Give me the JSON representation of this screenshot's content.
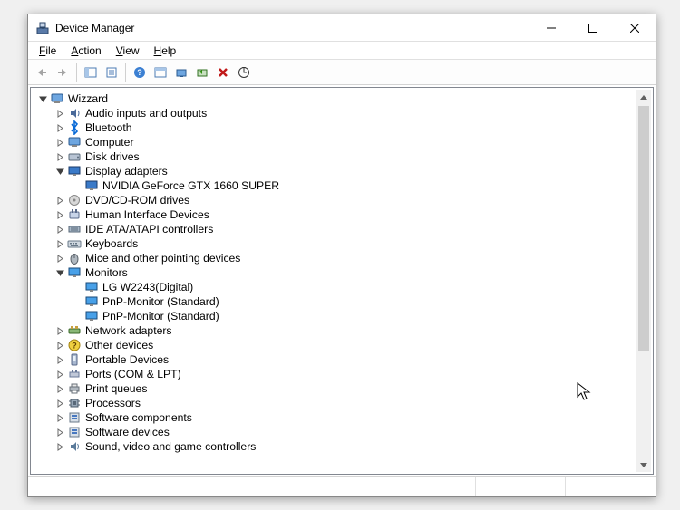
{
  "window": {
    "title": "Device Manager"
  },
  "menu": {
    "file": "File",
    "action": "Action",
    "view": "View",
    "help": "Help"
  },
  "toolbar_icons": [
    "back",
    "forward",
    "up-level",
    "show-hide-tree",
    "help",
    "properties",
    "update",
    "computer",
    "add-legacy",
    "remove",
    "rescan"
  ],
  "tree": {
    "root": {
      "label": "Wizzard",
      "expanded": true,
      "icon": "computer-root",
      "children": [
        {
          "label": "Audio inputs and outputs",
          "icon": "audio",
          "expanded": false,
          "hasChildren": true
        },
        {
          "label": "Bluetooth",
          "icon": "bluetooth",
          "expanded": false,
          "hasChildren": true
        },
        {
          "label": "Computer",
          "icon": "computer",
          "expanded": false,
          "hasChildren": true
        },
        {
          "label": "Disk drives",
          "icon": "disk",
          "expanded": false,
          "hasChildren": true
        },
        {
          "label": "Display adapters",
          "icon": "display",
          "expanded": true,
          "hasChildren": true,
          "children": [
            {
              "label": "NVIDIA GeForce GTX 1660 SUPER",
              "icon": "display",
              "hasChildren": false
            }
          ]
        },
        {
          "label": "DVD/CD-ROM drives",
          "icon": "optical",
          "expanded": false,
          "hasChildren": true
        },
        {
          "label": "Human Interface Devices",
          "icon": "hid",
          "expanded": false,
          "hasChildren": true
        },
        {
          "label": "IDE ATA/ATAPI controllers",
          "icon": "ide",
          "expanded": false,
          "hasChildren": true
        },
        {
          "label": "Keyboards",
          "icon": "keyboard",
          "expanded": false,
          "hasChildren": true
        },
        {
          "label": "Mice and other pointing devices",
          "icon": "mouse",
          "expanded": false,
          "hasChildren": true
        },
        {
          "label": "Monitors",
          "icon": "monitor",
          "expanded": true,
          "hasChildren": true,
          "children": [
            {
              "label": "LG W2243(Digital)",
              "icon": "monitor",
              "hasChildren": false
            },
            {
              "label": "PnP-Monitor (Standard)",
              "icon": "monitor",
              "hasChildren": false
            },
            {
              "label": "PnP-Monitor (Standard)",
              "icon": "monitor",
              "hasChildren": false
            }
          ]
        },
        {
          "label": "Network adapters",
          "icon": "network",
          "expanded": false,
          "hasChildren": true
        },
        {
          "label": "Other devices",
          "icon": "other",
          "expanded": false,
          "hasChildren": true
        },
        {
          "label": "Portable Devices",
          "icon": "portable",
          "expanded": false,
          "hasChildren": true
        },
        {
          "label": "Ports (COM & LPT)",
          "icon": "ports",
          "expanded": false,
          "hasChildren": true
        },
        {
          "label": "Print queues",
          "icon": "print",
          "expanded": false,
          "hasChildren": true
        },
        {
          "label": "Processors",
          "icon": "cpu",
          "expanded": false,
          "hasChildren": true
        },
        {
          "label": "Software components",
          "icon": "software",
          "expanded": false,
          "hasChildren": true
        },
        {
          "label": "Software devices",
          "icon": "software",
          "expanded": false,
          "hasChildren": true
        },
        {
          "label": "Sound, video and game controllers",
          "icon": "sound",
          "expanded": false,
          "hasChildren": true
        }
      ]
    }
  }
}
